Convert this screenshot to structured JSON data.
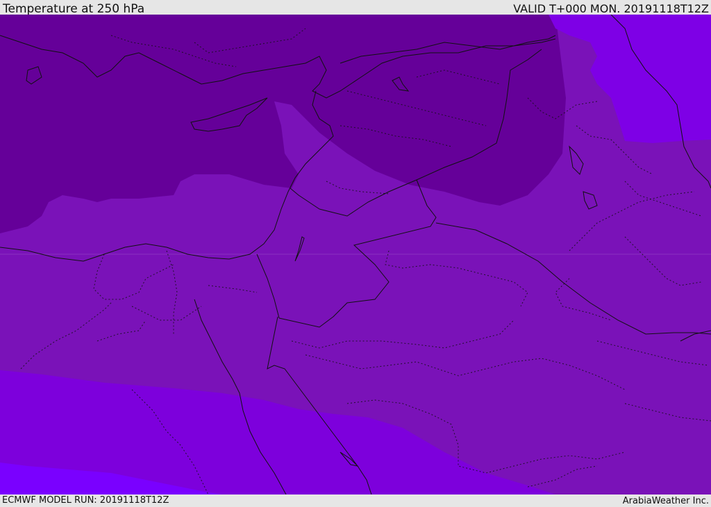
{
  "header": {
    "title": "Temperature at 250 hPa",
    "valid": "VALID T+000 MON. 20191118T12Z"
  },
  "footer": {
    "model_run": "ECMWF MODEL RUN: 20191118T12Z",
    "credit": "ArabiaWeather Inc."
  },
  "colors": {
    "band_darkest": "#650099",
    "band_dark": "#7212b0",
    "band_mid": "#7a12b8",
    "band_light": "#7d00dc",
    "band_lightest": "#7a00ff",
    "band_northeast": "#7e00e6",
    "lines": "#111111"
  }
}
